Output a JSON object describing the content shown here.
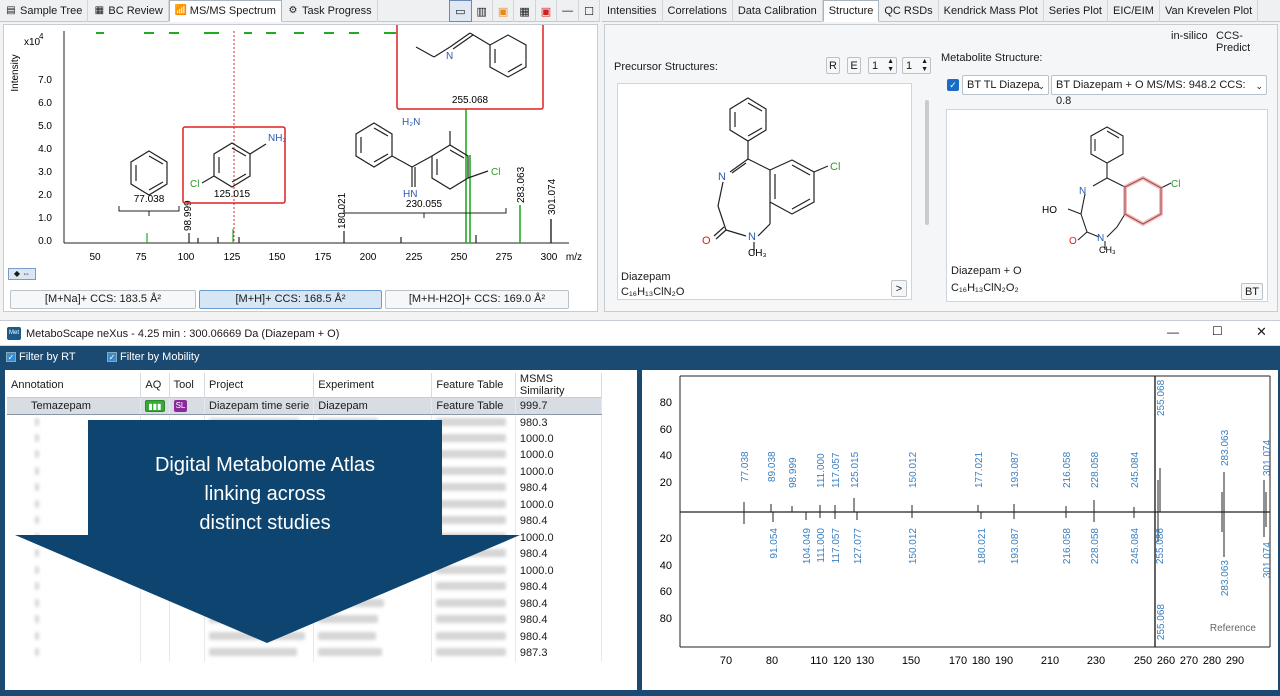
{
  "left_tabs": [
    {
      "label": "Sample Tree",
      "icon": "tree-icon"
    },
    {
      "label": "BC Review",
      "icon": "review-icon"
    },
    {
      "label": "MS/MS Spectrum",
      "icon": "spectrum-icon",
      "active": true
    },
    {
      "label": "Task Progress",
      "icon": "gear-icon"
    }
  ],
  "right_tabs": [
    {
      "label": "Intensities"
    },
    {
      "label": "Correlations"
    },
    {
      "label": "Data Calibration"
    },
    {
      "label": "Structure",
      "active": true
    },
    {
      "label": "QC RSDs"
    },
    {
      "label": "Kendrick Mass Plot"
    },
    {
      "label": "Series Plot"
    },
    {
      "label": "EIC/EIM"
    },
    {
      "label": "Van Krevelen Plot"
    }
  ],
  "msms": {
    "ylabel": "Intensity",
    "yexp": "x10",
    "yexp_power": "4",
    "xlabel": "m/z",
    "yticks": [
      "0.0",
      "1.0",
      "2.0",
      "3.0",
      "4.0",
      "5.0",
      "6.0",
      "7.0"
    ],
    "xticks": [
      "50",
      "75",
      "100",
      "125",
      "150",
      "175",
      "200",
      "225",
      "250",
      "275",
      "300"
    ],
    "peak_labels": [
      "98.999",
      "180.021",
      "283.063",
      "301.074"
    ],
    "fragments": [
      "77.038",
      "125.015",
      "230.055",
      "255.068"
    ],
    "ccs_buttons": [
      "[M+Na]+ CCS: 183.5 Å²",
      "[M+H]+ CCS: 168.5 Å²",
      "[M+H-H2O]+ CCS: 169.0 Å²"
    ]
  },
  "structure": {
    "insilico": "in-silico",
    "ccs_predict": "CCS-Predict",
    "precursor_label": "Precursor Structures:",
    "btn_r": "R",
    "btn_e": "E",
    "spin1": "1",
    "spin2": "1",
    "precursor_name": "Diazepam",
    "precursor_formula": "C₁₆H₁₃ClN₂O",
    "next_btn": ">",
    "metabolite_label": "Metabolite Structure:",
    "dd1": "BT TL Diazepa",
    "dd2": "BT Diazepam + O MS/MS: 948.2 CCS: 0.8",
    "metabolite_name": "Diazepam + O",
    "metabolite_formula": "C₁₆H₁₃ClN₂O₂",
    "bt_btn": "BT"
  },
  "nexus": {
    "title": "MetaboScape neXus - 4.25 min : 300.06669 Da (Diazepam + O)",
    "filter_rt": "Filter by RT",
    "filter_mobility": "Filter by Mobility",
    "columns": [
      "Annotation",
      "AQ",
      "Tool",
      "Project",
      "Experiment",
      "Feature Table",
      "MSMS Similarity"
    ],
    "first_row": {
      "annotation": "Temazepam",
      "project": "Diazepam time serie",
      "experiment": "Diazepam",
      "feature_table": "Feature Table",
      "similarity": "999.7"
    },
    "similarities": [
      "980.3",
      "1000.0",
      "1000.0",
      "1000.0",
      "980.4",
      "1000.0",
      "980.4",
      "1000.0",
      "980.4",
      "1000.0",
      "980.4",
      "980.4",
      "980.4",
      "980.4",
      "987.3"
    ],
    "banner": [
      "Digital Metabolome Atlas",
      "linking across",
      "distinct studies"
    ],
    "mirror": {
      "yticks": [
        "80",
        "60",
        "40",
        "20",
        "20",
        "40",
        "60",
        "80"
      ],
      "xticks": [
        "70",
        "80",
        "90",
        "110",
        "130",
        "150",
        "170",
        "190",
        "210",
        "230",
        "250",
        "270",
        "290"
      ],
      "xtick_labels_shown": [
        "70",
        "80",
        "90",
        "100",
        "110",
        "120",
        "130",
        "150",
        "170",
        "180",
        "190",
        "210",
        "220",
        "230",
        "250",
        "260",
        "270",
        "280",
        "290"
      ],
      "reference": "Reference",
      "top_peaks": [
        "77.038",
        "89.038",
        "98.999",
        "111.000",
        "117.057",
        "125.015",
        "150.012",
        "177.021",
        "193.087",
        "216.058",
        "228.058",
        "245.084",
        "255.068",
        "283.063",
        "301.074"
      ],
      "bottom_peaks": [
        "91.054",
        "104.049",
        "111.000",
        "117.057",
        "127.077",
        "150.012",
        "180.021",
        "193.087",
        "216.058",
        "228.058",
        "245.084",
        "255.086",
        "283.063",
        "301.074",
        "255.068"
      ]
    }
  },
  "colors": {
    "accent": "#1a5a8a",
    "banner": "#0e4570",
    "red": "#e02020",
    "green": "#22aa22",
    "label_blue": "#3a7fc0"
  }
}
